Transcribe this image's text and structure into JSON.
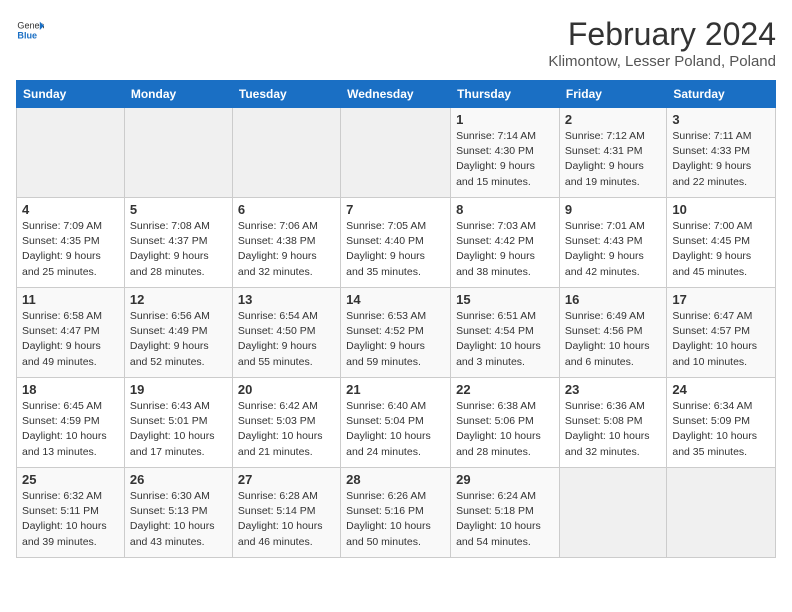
{
  "header": {
    "logo_general": "General",
    "logo_blue": "Blue",
    "title": "February 2024",
    "subtitle": "Klimontow, Lesser Poland, Poland"
  },
  "columns": [
    "Sunday",
    "Monday",
    "Tuesday",
    "Wednesday",
    "Thursday",
    "Friday",
    "Saturday"
  ],
  "weeks": [
    [
      {
        "day": "",
        "info": ""
      },
      {
        "day": "",
        "info": ""
      },
      {
        "day": "",
        "info": ""
      },
      {
        "day": "",
        "info": ""
      },
      {
        "day": "1",
        "info": "Sunrise: 7:14 AM\nSunset: 4:30 PM\nDaylight: 9 hours\nand 15 minutes."
      },
      {
        "day": "2",
        "info": "Sunrise: 7:12 AM\nSunset: 4:31 PM\nDaylight: 9 hours\nand 19 minutes."
      },
      {
        "day": "3",
        "info": "Sunrise: 7:11 AM\nSunset: 4:33 PM\nDaylight: 9 hours\nand 22 minutes."
      }
    ],
    [
      {
        "day": "4",
        "info": "Sunrise: 7:09 AM\nSunset: 4:35 PM\nDaylight: 9 hours\nand 25 minutes."
      },
      {
        "day": "5",
        "info": "Sunrise: 7:08 AM\nSunset: 4:37 PM\nDaylight: 9 hours\nand 28 minutes."
      },
      {
        "day": "6",
        "info": "Sunrise: 7:06 AM\nSunset: 4:38 PM\nDaylight: 9 hours\nand 32 minutes."
      },
      {
        "day": "7",
        "info": "Sunrise: 7:05 AM\nSunset: 4:40 PM\nDaylight: 9 hours\nand 35 minutes."
      },
      {
        "day": "8",
        "info": "Sunrise: 7:03 AM\nSunset: 4:42 PM\nDaylight: 9 hours\nand 38 minutes."
      },
      {
        "day": "9",
        "info": "Sunrise: 7:01 AM\nSunset: 4:43 PM\nDaylight: 9 hours\nand 42 minutes."
      },
      {
        "day": "10",
        "info": "Sunrise: 7:00 AM\nSunset: 4:45 PM\nDaylight: 9 hours\nand 45 minutes."
      }
    ],
    [
      {
        "day": "11",
        "info": "Sunrise: 6:58 AM\nSunset: 4:47 PM\nDaylight: 9 hours\nand 49 minutes."
      },
      {
        "day": "12",
        "info": "Sunrise: 6:56 AM\nSunset: 4:49 PM\nDaylight: 9 hours\nand 52 minutes."
      },
      {
        "day": "13",
        "info": "Sunrise: 6:54 AM\nSunset: 4:50 PM\nDaylight: 9 hours\nand 55 minutes."
      },
      {
        "day": "14",
        "info": "Sunrise: 6:53 AM\nSunset: 4:52 PM\nDaylight: 9 hours\nand 59 minutes."
      },
      {
        "day": "15",
        "info": "Sunrise: 6:51 AM\nSunset: 4:54 PM\nDaylight: 10 hours\nand 3 minutes."
      },
      {
        "day": "16",
        "info": "Sunrise: 6:49 AM\nSunset: 4:56 PM\nDaylight: 10 hours\nand 6 minutes."
      },
      {
        "day": "17",
        "info": "Sunrise: 6:47 AM\nSunset: 4:57 PM\nDaylight: 10 hours\nand 10 minutes."
      }
    ],
    [
      {
        "day": "18",
        "info": "Sunrise: 6:45 AM\nSunset: 4:59 PM\nDaylight: 10 hours\nand 13 minutes."
      },
      {
        "day": "19",
        "info": "Sunrise: 6:43 AM\nSunset: 5:01 PM\nDaylight: 10 hours\nand 17 minutes."
      },
      {
        "day": "20",
        "info": "Sunrise: 6:42 AM\nSunset: 5:03 PM\nDaylight: 10 hours\nand 21 minutes."
      },
      {
        "day": "21",
        "info": "Sunrise: 6:40 AM\nSunset: 5:04 PM\nDaylight: 10 hours\nand 24 minutes."
      },
      {
        "day": "22",
        "info": "Sunrise: 6:38 AM\nSunset: 5:06 PM\nDaylight: 10 hours\nand 28 minutes."
      },
      {
        "day": "23",
        "info": "Sunrise: 6:36 AM\nSunset: 5:08 PM\nDaylight: 10 hours\nand 32 minutes."
      },
      {
        "day": "24",
        "info": "Sunrise: 6:34 AM\nSunset: 5:09 PM\nDaylight: 10 hours\nand 35 minutes."
      }
    ],
    [
      {
        "day": "25",
        "info": "Sunrise: 6:32 AM\nSunset: 5:11 PM\nDaylight: 10 hours\nand 39 minutes."
      },
      {
        "day": "26",
        "info": "Sunrise: 6:30 AM\nSunset: 5:13 PM\nDaylight: 10 hours\nand 43 minutes."
      },
      {
        "day": "27",
        "info": "Sunrise: 6:28 AM\nSunset: 5:14 PM\nDaylight: 10 hours\nand 46 minutes."
      },
      {
        "day": "28",
        "info": "Sunrise: 6:26 AM\nSunset: 5:16 PM\nDaylight: 10 hours\nand 50 minutes."
      },
      {
        "day": "29",
        "info": "Sunrise: 6:24 AM\nSunset: 5:18 PM\nDaylight: 10 hours\nand 54 minutes."
      },
      {
        "day": "",
        "info": ""
      },
      {
        "day": "",
        "info": ""
      }
    ]
  ]
}
